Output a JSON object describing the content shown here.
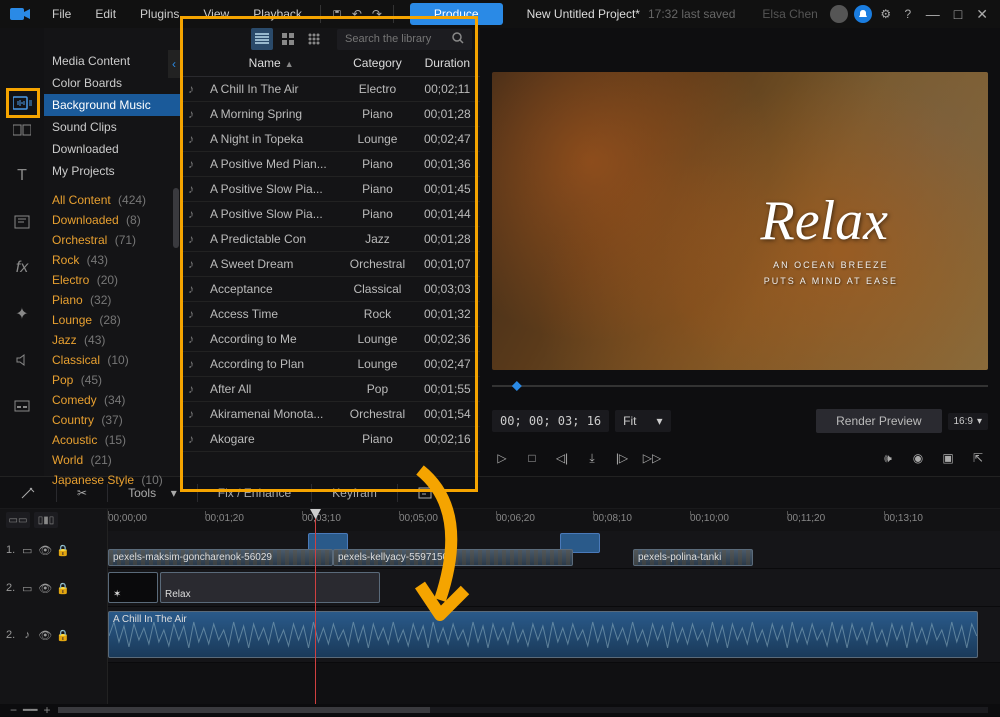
{
  "menu": {
    "items": [
      "File",
      "Edit",
      "Plugins",
      "View",
      "Playback"
    ],
    "produce_label": "Produce",
    "project_title": "New Untitled Project*",
    "saved_text": "17:32 last saved",
    "user_name": "Elsa Chen"
  },
  "library": {
    "search_placeholder": "Search the library",
    "categories": [
      "Media Content",
      "Color Boards",
      "Background Music",
      "Sound Clips",
      "Downloaded",
      "My Projects"
    ],
    "selected_category_index": 2,
    "filters": [
      {
        "name": "All Content",
        "count": 424
      },
      {
        "name": "Downloaded",
        "count": 8
      },
      {
        "name": "Orchestral",
        "count": 71
      },
      {
        "name": "Rock",
        "count": 43
      },
      {
        "name": "Electro",
        "count": 20
      },
      {
        "name": "Piano",
        "count": 32
      },
      {
        "name": "Lounge",
        "count": 28
      },
      {
        "name": "Jazz",
        "count": 43
      },
      {
        "name": "Classical",
        "count": 10
      },
      {
        "name": "Pop",
        "count": 45
      },
      {
        "name": "Comedy",
        "count": 34
      },
      {
        "name": "Country",
        "count": 37
      },
      {
        "name": "Acoustic",
        "count": 15
      },
      {
        "name": "World",
        "count": 21
      },
      {
        "name": "Japanese Style",
        "count": 10
      }
    ],
    "columns": {
      "name": "Name",
      "category": "Category",
      "duration": "Duration"
    },
    "tracks": [
      {
        "name": "A Chill In The Air",
        "category": "Electro",
        "duration": "00;02;11"
      },
      {
        "name": "A Morning Spring",
        "category": "Piano",
        "duration": "00;01;28"
      },
      {
        "name": "A Night in Topeka",
        "category": "Lounge",
        "duration": "00;02;47"
      },
      {
        "name": "A Positive Med Pian...",
        "category": "Piano",
        "duration": "00;01;36"
      },
      {
        "name": "A Positive Slow Pia...",
        "category": "Piano",
        "duration": "00;01;45"
      },
      {
        "name": "A Positive Slow Pia...",
        "category": "Piano",
        "duration": "00;01;44"
      },
      {
        "name": "A Predictable Con",
        "category": "Jazz",
        "duration": "00;01;28"
      },
      {
        "name": "A Sweet Dream",
        "category": "Orchestral",
        "duration": "00;01;07"
      },
      {
        "name": "Acceptance",
        "category": "Classical",
        "duration": "00;03;03"
      },
      {
        "name": "Access Time",
        "category": "Rock",
        "duration": "00;01;32"
      },
      {
        "name": "According to Me",
        "category": "Lounge",
        "duration": "00;02;36"
      },
      {
        "name": "According to Plan",
        "category": "Lounge",
        "duration": "00;02;47"
      },
      {
        "name": "After All",
        "category": "Pop",
        "duration": "00;01;55"
      },
      {
        "name": "Akiramenai Monota...",
        "category": "Orchestral",
        "duration": "00;01;54"
      },
      {
        "name": "Akogare",
        "category": "Piano",
        "duration": "00;02;16"
      }
    ]
  },
  "preview": {
    "title_text": "Relax",
    "subtitle_1": "AN OCEAN BREEZE",
    "subtitle_2": "PUTS A MIND AT EASE",
    "timecode": "00; 00; 03; 16",
    "fit_label": "Fit",
    "render_label": "Render Preview",
    "aspect_label": "16:9"
  },
  "timeline": {
    "tools_label": "Tools",
    "fix_label": "Fix / Enhance",
    "keyframe_label": "Keyfram",
    "ticks": [
      "00;00;00",
      "00;01;20",
      "00;03;10",
      "00;05;00",
      "00;06;20",
      "00;08;10",
      "00;10;00",
      "00;11;20",
      "00;13;10"
    ],
    "tracks": [
      {
        "num": "1.",
        "clips": [
          "pexels-maksim-goncharenok-56029",
          "pexels-kellyacy-5597150",
          "pexels-polina-tanki"
        ]
      },
      {
        "num": "2.",
        "clips": [
          "Relax"
        ]
      },
      {
        "num": "2.",
        "clips": [
          "A Chill In The Air"
        ]
      }
    ]
  }
}
